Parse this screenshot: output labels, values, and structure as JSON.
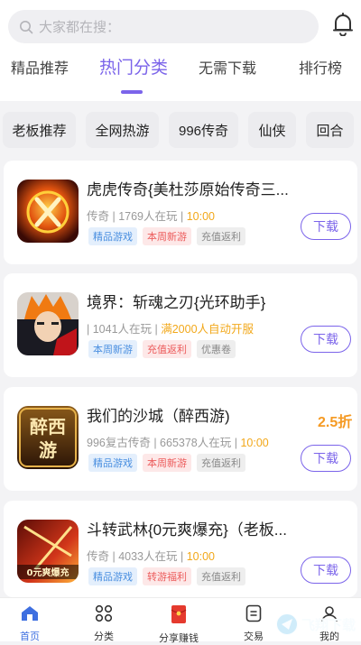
{
  "search": {
    "placeholder": "大家都在搜："
  },
  "tabs": [
    {
      "label": "精品推荐"
    },
    {
      "label": "热门分类"
    },
    {
      "label": "无需下载"
    },
    {
      "label": "排行榜"
    }
  ],
  "chips": [
    "老板推荐",
    "全网热游",
    "996传奇",
    "仙侠",
    "回合"
  ],
  "games": [
    {
      "title": "虎虎传奇{美杜莎原始传奇三...",
      "meta_prefix": "传奇 | 1769人在玩 | ",
      "meta_highlight": "10:00",
      "tags": [
        "精品游戏",
        "本周新游",
        "充值返利"
      ],
      "button": "下载",
      "discount": ""
    },
    {
      "title": "境界：斩魂之刃{光环助手}",
      "meta_prefix": "| 1041人在玩 | ",
      "meta_highlight": "满2000人自动开服",
      "tags": [
        "本周新游",
        "充值返利",
        "优惠卷"
      ],
      "button": "下载",
      "discount": ""
    },
    {
      "title": "我们的沙城（醉西游)",
      "meta_prefix": "996复古传奇 | 665378人在玩 | ",
      "meta_highlight": "10:00",
      "tags": [
        "精品游戏",
        "本周新游",
        "充值返利"
      ],
      "button": "下载",
      "discount": "2.5折"
    },
    {
      "title": "斗转武林{0元爽爆充}（老板...",
      "meta_prefix": "传奇 | 4033人在玩 | ",
      "meta_highlight": "10:00",
      "tags": [
        "精品游戏",
        "转游福利",
        "充值返利"
      ],
      "button": "下载",
      "discount": ""
    }
  ],
  "icon_texts": {
    "game3": "醉西游",
    "game4": "0元爽爆充"
  },
  "bottom_nav": [
    {
      "label": "首页",
      "icon": "home-icon"
    },
    {
      "label": "分类",
      "icon": "grid-icon"
    },
    {
      "label": "分享赚钱",
      "icon": "red-envelope-icon"
    },
    {
      "label": "交易",
      "icon": "trade-icon"
    },
    {
      "label": "我的",
      "icon": "user-icon"
    }
  ],
  "watermark": "飞翔下载",
  "colors": {
    "accent": "#7b64ea",
    "nav_active": "#3e6fe0",
    "highlight": "#f2a81a"
  }
}
